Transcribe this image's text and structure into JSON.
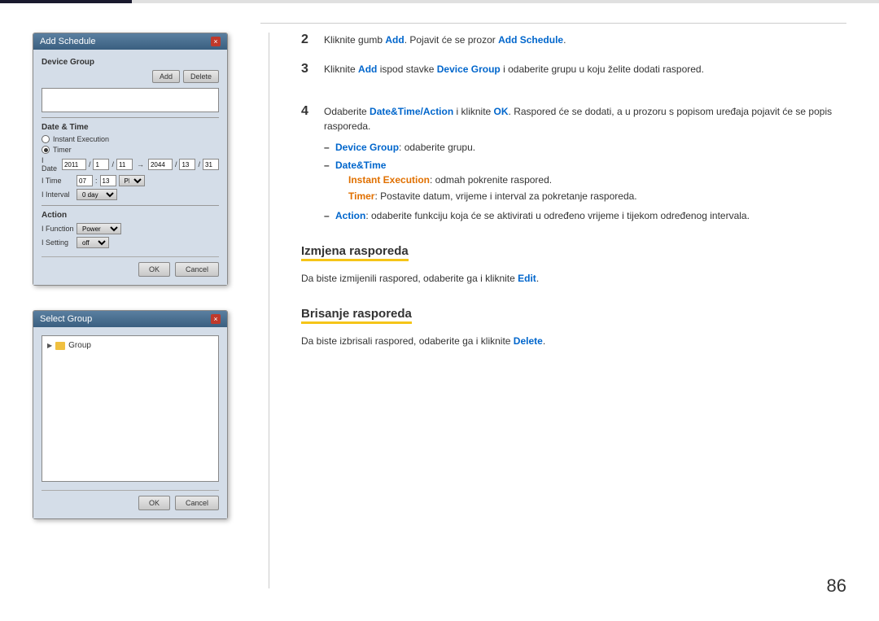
{
  "topbar": {
    "accent_color": "#1a1a2e",
    "line_color": "#ccc"
  },
  "dialog_add_schedule": {
    "title": "Add Schedule",
    "close_label": "×",
    "section_device_group": "Device Group",
    "btn_add": "Add",
    "btn_delete": "Delete",
    "section_date_time": "Date & Time",
    "radio_instant": "Instant Execution",
    "radio_timer": "Timer",
    "date_label": "I Date",
    "date_from": "2011",
    "date_sep1": "/",
    "date_m1": "1",
    "date_sep2": "/",
    "date_d1": "11",
    "date_arrow": "→",
    "date_to_year": "2044",
    "date_sep3": "/",
    "date_to_m": "13",
    "date_sep4": "/",
    "date_to_d": "31",
    "time_label": "I Time",
    "time_h": "07",
    "time_m": "13",
    "time_ampm": "PM",
    "interval_label": "I Interval",
    "interval_val": "0 day",
    "section_action": "Action",
    "function_label": "I Function",
    "function_val": "Power",
    "setting_label": "I Setting",
    "setting_val": "off",
    "btn_ok": "OK",
    "btn_cancel": "Cancel"
  },
  "dialog_select_group": {
    "title": "Select Group",
    "close_label": "×",
    "tree_root": "Group",
    "btn_ok": "OK",
    "btn_cancel": "Cancel"
  },
  "steps": {
    "step2_number": "2",
    "step2_text": "Kliknite gumb ",
    "step2_add": "Add",
    "step2_mid": ". Pojavit će se prozor ",
    "step2_add_schedule": "Add Schedule",
    "step2_end": ".",
    "step3_number": "3",
    "step3_text": "Kliknite ",
    "step3_add": "Add",
    "step3_mid": " ispod stavke ",
    "step3_device_group": "Device Group",
    "step3_end": " i odaberite grupu u koju želite dodati raspored.",
    "step4_number": "4",
    "step4_text_pre": "Odaberite ",
    "step4_datetime": "Date&Time/Action",
    "step4_mid": " i kliknite ",
    "step4_ok": "OK",
    "step4_post": ". Raspored će se dodati, a u prozoru s popisom uređaja pojavit će se popis rasporeda.",
    "bullet1_dash": "–",
    "bullet1_label": "Device Group",
    "bullet1_text": ": odaberite grupu.",
    "bullet2_dash": "–",
    "bullet2_label": "Date&Time",
    "sub_instant_label": "Instant Execution",
    "sub_instant_text": ": odmah pokrenite raspored.",
    "sub_timer_label": "Timer",
    "sub_timer_text": ": Postavite datum, vrijeme i interval za pokretanje rasporeda.",
    "bullet3_dash": "–",
    "bullet3_label": "Action",
    "bullet3_text": ": odaberite funkciju koja će se aktivirati u određeno vrijeme i tijekom određenog intervala.",
    "section_izmjena": "Izmjena rasporeda",
    "izmjena_text": "Da biste izmijenili raspored, odaberite ga i kliknite ",
    "izmjena_edit": "Edit",
    "izmjena_end": ".",
    "section_brisanje": "Brisanje rasporeda",
    "brisanje_text": "Da biste izbrisali raspored, odaberite ga i kliknite ",
    "brisanje_delete": "Delete",
    "brisanje_end": ".",
    "page_number": "86"
  }
}
